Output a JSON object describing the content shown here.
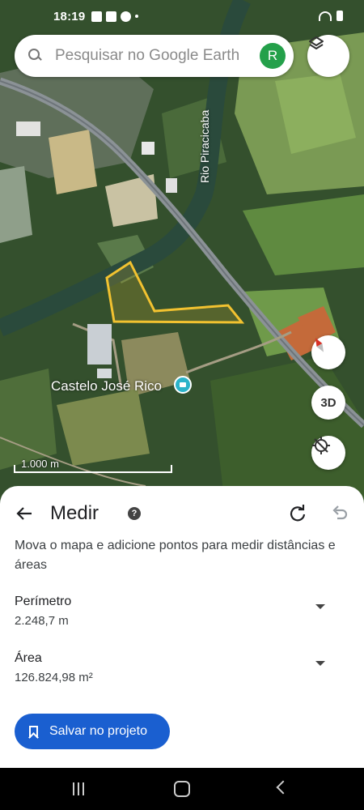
{
  "status_bar": {
    "time": "18:19"
  },
  "search": {
    "placeholder": "Pesquisar no Google Earth",
    "avatar_initial": "R"
  },
  "map": {
    "river_label": "Rio Piracicaba",
    "place_label": "Castelo José Rico",
    "scale_label": "1.000 m",
    "view_mode_label": "3D"
  },
  "panel": {
    "title": "Medir",
    "instruction": "Mova o mapa e adicione pontos para medir distâncias e áreas",
    "metrics": [
      {
        "label": "Perímetro",
        "value": "2.248,7 m"
      },
      {
        "label": "Área",
        "value": "126.824,98 m²"
      }
    ],
    "save_label": "Salvar no projeto"
  },
  "colors": {
    "measure_outline": "#f2c230",
    "primary_button": "#1a5fd0",
    "avatar_bg": "#24a04a"
  }
}
